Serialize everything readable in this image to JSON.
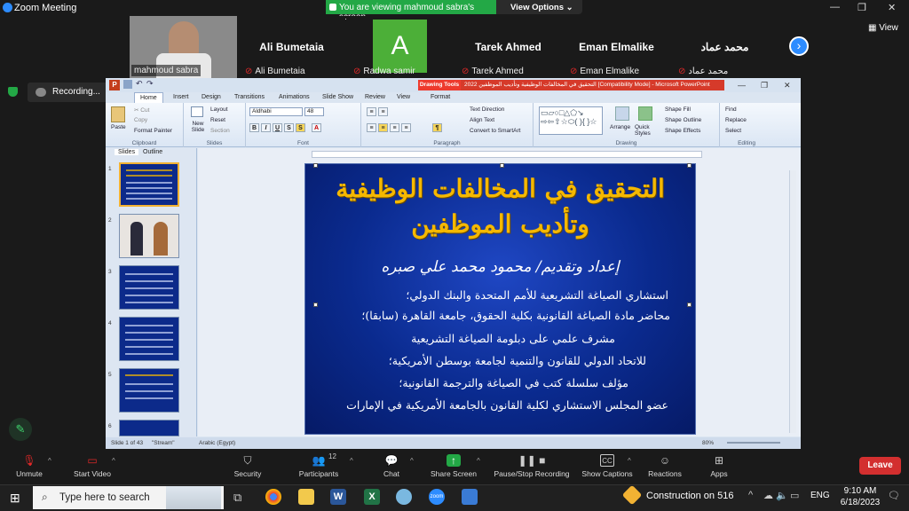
{
  "window": {
    "title": "Zoom Meeting"
  },
  "share_banner": {
    "text": "You are viewing mahmoud sabra's screen",
    "view_options": "View Options"
  },
  "gallery": {
    "tiles": [
      {
        "name": "",
        "label": "mahmoud sabra",
        "type": "video"
      },
      {
        "name": "Ali Bumetaia",
        "label": "Ali Bumetaia",
        "type": "name",
        "muted": true
      },
      {
        "name": "A",
        "label": "Radwa samir",
        "type": "avatar",
        "muted": true,
        "avatar_color": "#4caf38"
      },
      {
        "name": "Tarek Ahmed",
        "label": "Tarek Ahmed",
        "type": "name",
        "muted": true
      },
      {
        "name": "Eman Elmalike",
        "label": "Eman Elmalike",
        "type": "name",
        "muted": true
      },
      {
        "name": "محمد عماد",
        "label": "محمد عماد",
        "type": "name",
        "muted": true
      }
    ],
    "view_label": "View"
  },
  "recording": {
    "label": "Recording..."
  },
  "powerpoint": {
    "drawing_tools": "Drawing Tools",
    "file_title": "التحقيق في المخالفات الوظيفية وتأديب الموظفين 2022 [Compatibility Mode] - Microsoft PowerPoint",
    "tabs": [
      "Home",
      "Insert",
      "Design",
      "Transitions",
      "Animations",
      "Slide Show",
      "Review",
      "View",
      "Format"
    ],
    "ribbon": {
      "clipboard": {
        "paste": "Paste",
        "cut": "Cut",
        "copy": "Copy",
        "format_painter": "Format Painter",
        "label": "Clipboard"
      },
      "slides": {
        "new_slide": "New Slide",
        "layout": "Layout",
        "reset": "Reset",
        "section": "Section",
        "label": "Slides"
      },
      "font": {
        "name": "Aldhabi",
        "size": "48",
        "label": "Font"
      },
      "paragraph": {
        "text_direction": "Text Direction",
        "align_text": "Align Text",
        "smartart": "Convert to SmartArt",
        "label": "Paragraph"
      },
      "drawing": {
        "arrange": "Arrange",
        "quick_styles": "Quick Styles",
        "shape_fill": "Shape Fill",
        "shape_outline": "Shape Outline",
        "shape_effects": "Shape Effects",
        "label": "Drawing"
      },
      "editing": {
        "find": "Find",
        "replace": "Replace",
        "select": "Select",
        "label": "Editing"
      }
    },
    "pane_tabs": [
      "Slides",
      "Outline"
    ],
    "thumb_numbers": [
      "1",
      "2",
      "3",
      "4",
      "5",
      "6"
    ],
    "slide": {
      "title_line1": "التحقيق في المخالفات الوظيفية",
      "title_line2": "وتأديب الموظفين",
      "byline": "إعداد وتقديم/ محمود محمد علي صبره",
      "bullets": [
        "استشاري الصياغة التشريعية للأمم المتحدة والبنك الدولي؛",
        "محاضر مادة الصياغة القانونية بكلية الحقوق، جامعة القاهرة (سابقا)؛",
        "مشرف علمي على دبلومة الصياغة التشريعية",
        "للاتحاد الدولي للقانون والتنمية لجامعة بوسطن الأمريكية؛",
        "مؤلف سلسلة كتب في الصياغة والترجمة القانونية؛",
        "عضو المجلس الاستشاري لكلية القانون بالجامعة الأمريكية في الإمارات"
      ]
    },
    "status": {
      "slide": "Slide 1 of 43",
      "theme": "\"Stream\"",
      "language": "Arabic (Egypt)",
      "zoom": "80%"
    }
  },
  "toolbar": {
    "unmute": "Unmute",
    "start_video": "Start Video",
    "security": "Security",
    "participants": "Participants",
    "participants_count": "12",
    "chat": "Chat",
    "share_screen": "Share Screen",
    "pause_recording": "Pause/Stop Recording",
    "show_captions": "Show Captions",
    "reactions": "Reactions",
    "apps": "Apps",
    "leave": "Leave"
  },
  "taskbar": {
    "search_placeholder": "Type here to search",
    "notification": "Construction on 516",
    "lang": "ENG",
    "time": "9:10 AM",
    "date": "6/18/2023"
  }
}
